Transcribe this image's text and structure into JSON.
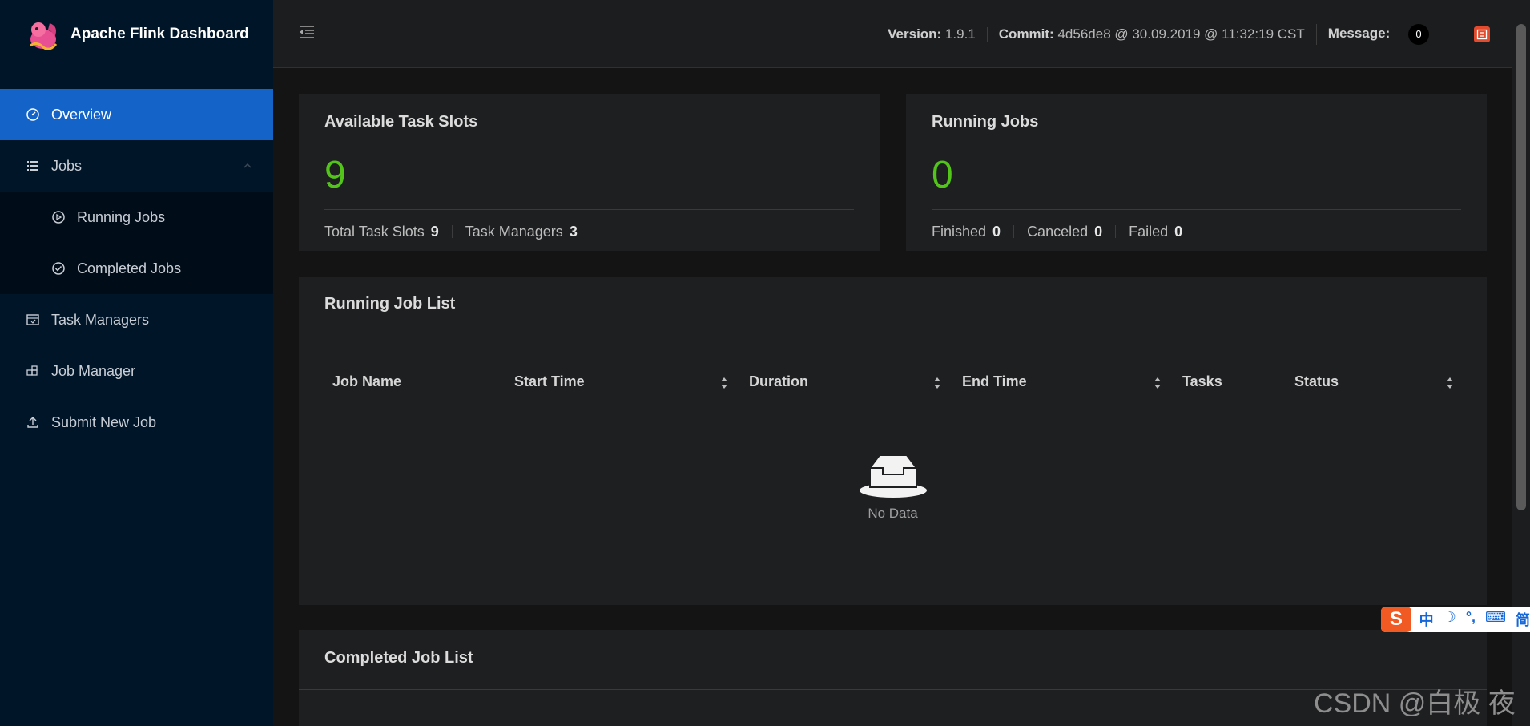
{
  "app": {
    "title": "Apache Flink Dashboard"
  },
  "sidebar": {
    "items": [
      {
        "label": "Overview",
        "icon": "dashboard-icon",
        "active": true
      },
      {
        "label": "Jobs",
        "icon": "list-icon",
        "expanded": true
      },
      {
        "label": "Running Jobs",
        "icon": "play-circle-icon"
      },
      {
        "label": "Completed Jobs",
        "icon": "check-circle-icon"
      },
      {
        "label": "Task Managers",
        "icon": "schedule-icon"
      },
      {
        "label": "Job Manager",
        "icon": "build-icon"
      },
      {
        "label": "Submit New Job",
        "icon": "upload-icon"
      }
    ]
  },
  "header": {
    "version_label": "Version:",
    "version": "1.9.1",
    "commit_label": "Commit:",
    "commit": "4d56de8 @ 30.09.2019 @ 11:32:19 CST",
    "message_label": "Message:",
    "message_count": "0"
  },
  "task_slots": {
    "title": "Available Task Slots",
    "available": "9",
    "total_label": "Total Task Slots",
    "total": "9",
    "tm_label": "Task Managers",
    "tm": "3"
  },
  "running_jobs": {
    "title": "Running Jobs",
    "count": "0",
    "finished_label": "Finished",
    "finished": "0",
    "canceled_label": "Canceled",
    "canceled": "0",
    "failed_label": "Failed",
    "failed": "0"
  },
  "running_job_list": {
    "title": "Running Job List",
    "columns": [
      "Job Name",
      "Start Time",
      "Duration",
      "End Time",
      "Tasks",
      "Status"
    ],
    "empty_text": "No Data"
  },
  "completed_job_list": {
    "title": "Completed Job List"
  },
  "colors": {
    "accent": "#1463c8",
    "success": "#52c41a",
    "sidebar_bg": "#011528"
  },
  "overlay": {
    "ime_logo": "S",
    "ime_items": [
      "中",
      "☽",
      "°,",
      "⌨",
      "简"
    ],
    "watermark": "CSDN @白极 夜"
  }
}
